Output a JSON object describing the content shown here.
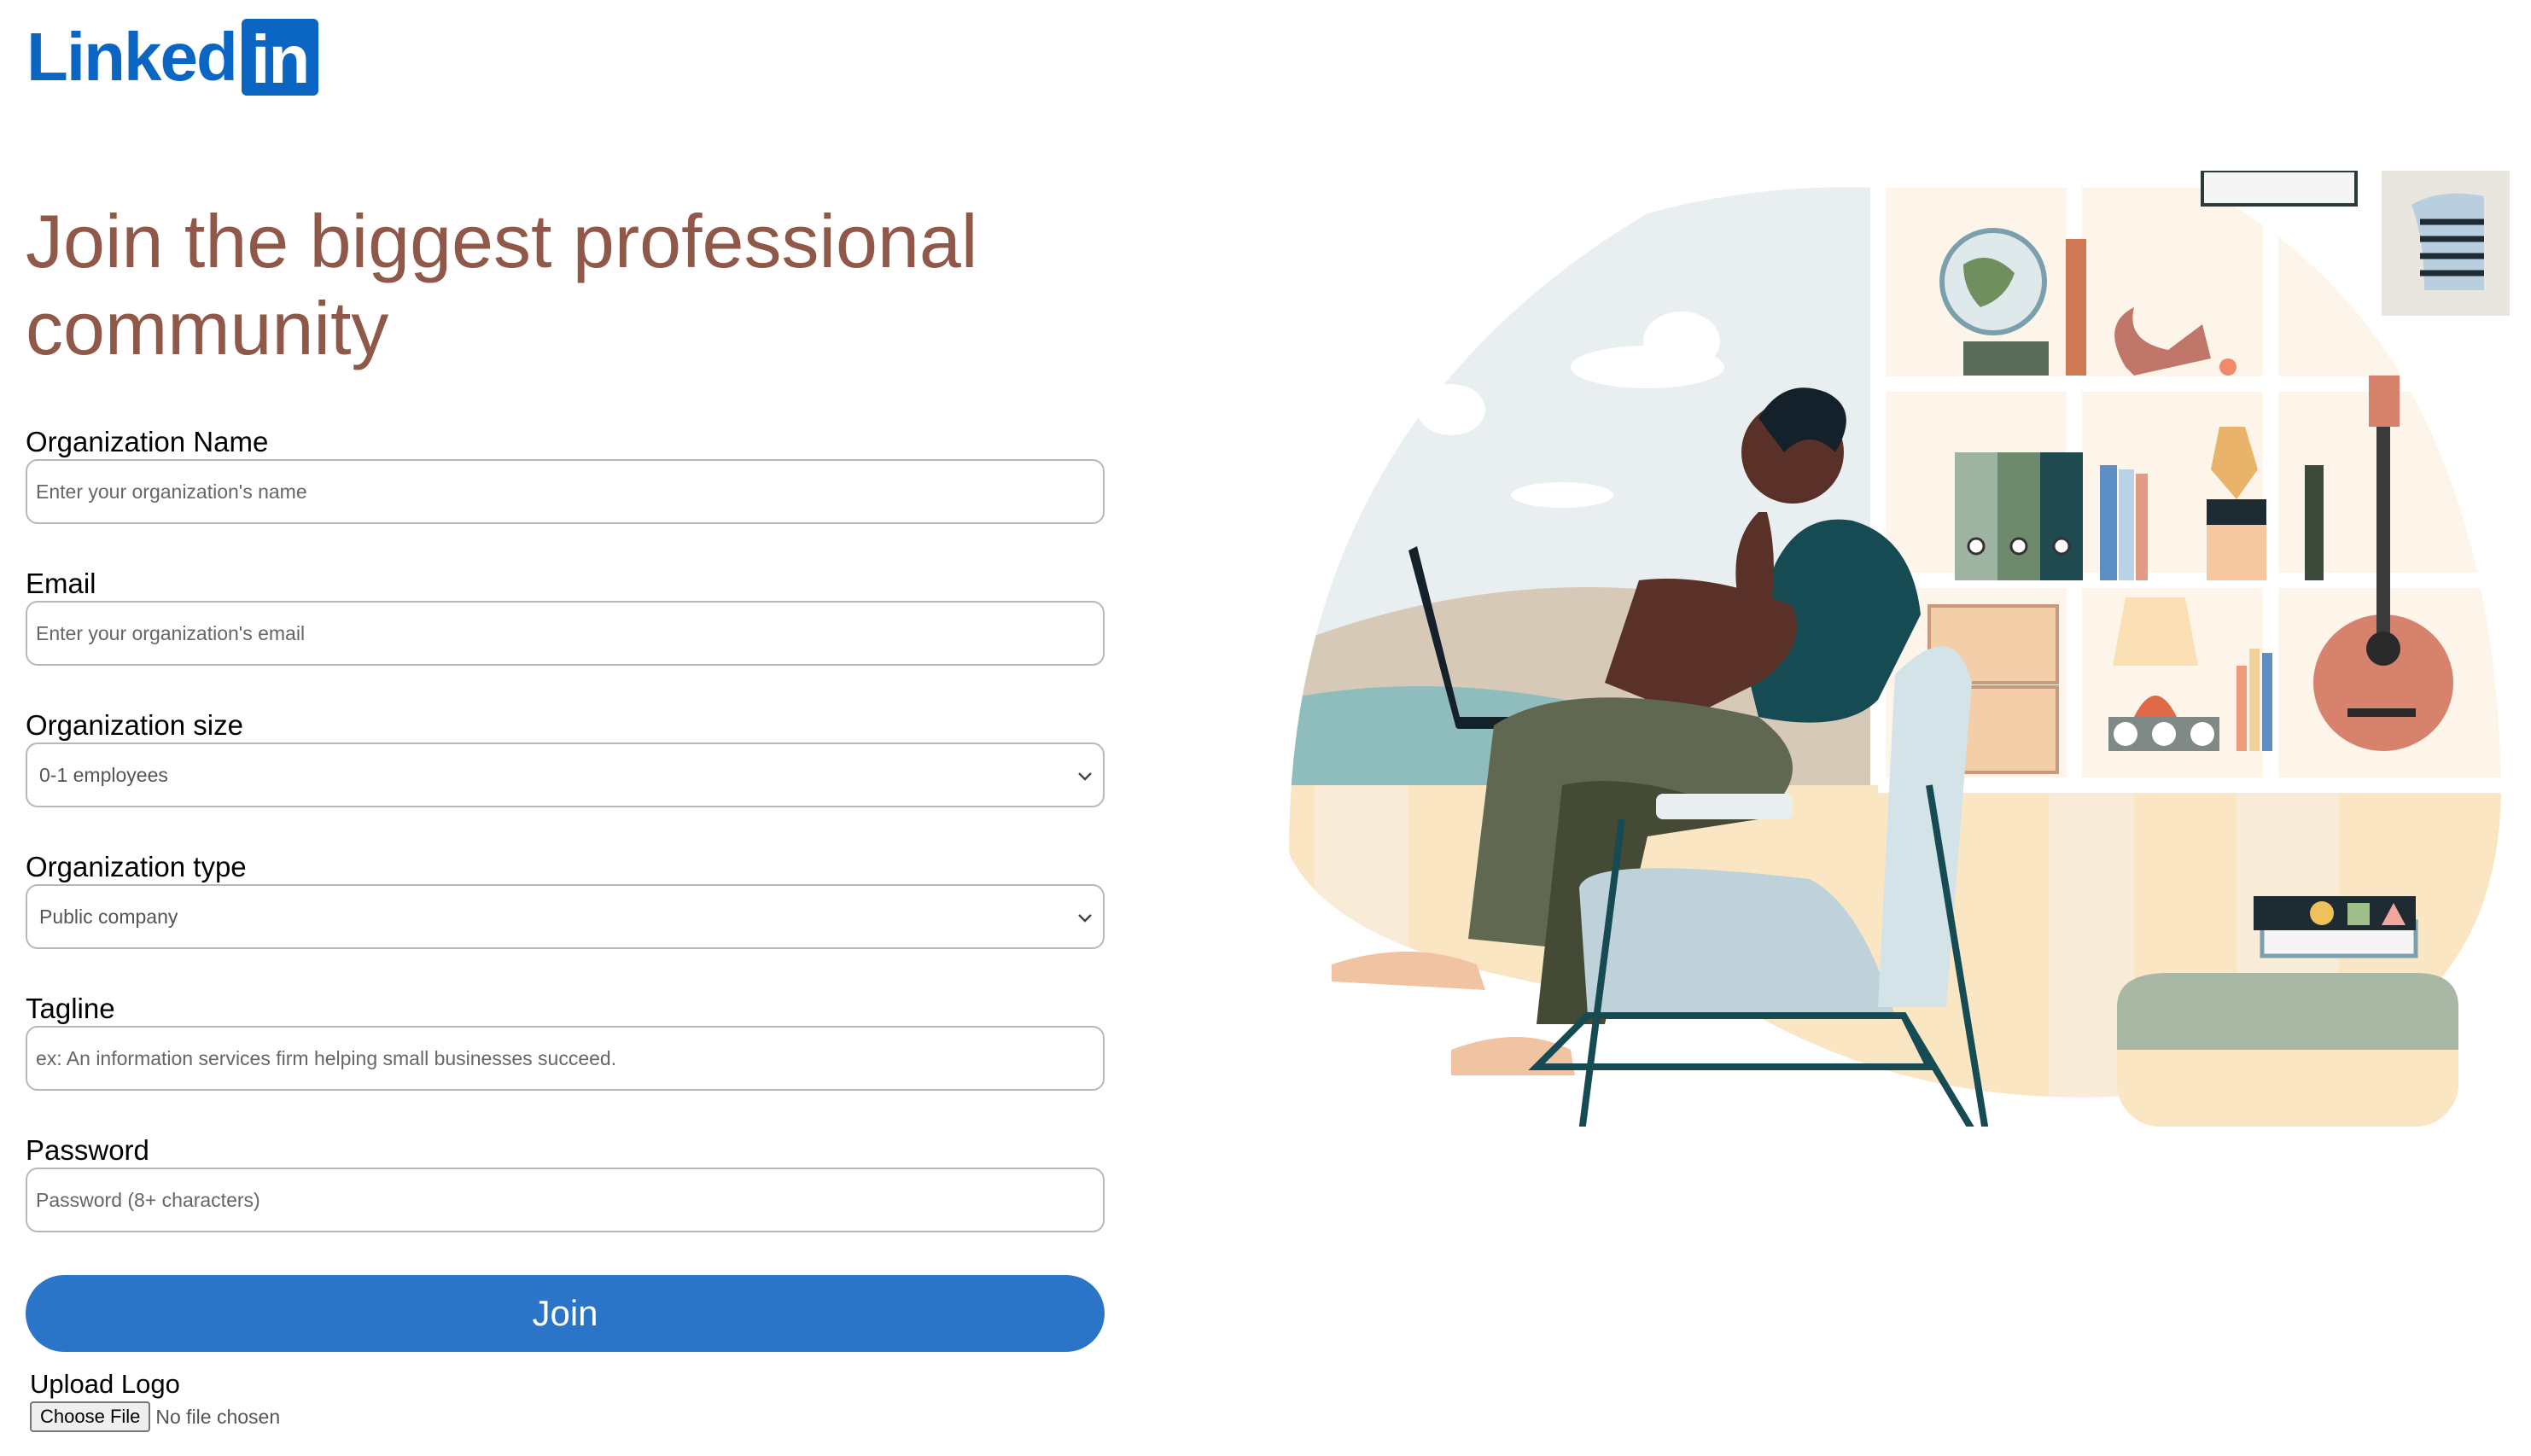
{
  "brand": {
    "logo_word": "Linked",
    "logo_box": "in"
  },
  "headline": "Join the biggest professional community",
  "form": {
    "org_name": {
      "label": "Organization Name",
      "placeholder": "Enter your organization's name"
    },
    "email": {
      "label": "Email",
      "placeholder": "Enter your organization's email"
    },
    "org_size": {
      "label": "Organization size",
      "selected": "0-1 employees"
    },
    "org_type": {
      "label": "Organization type",
      "selected": "Public company"
    },
    "tagline": {
      "label": "Tagline",
      "placeholder": "ex: An information services firm helping small businesses succeed."
    },
    "password": {
      "label": "Password",
      "placeholder": "Password (8+ characters)"
    },
    "join_label": "Join",
    "upload": {
      "label": "Upload Logo",
      "button": "Choose File",
      "status": "No file chosen"
    }
  },
  "colors": {
    "brand": "#0a66c2",
    "headline": "#8f5849",
    "button": "#2a75c8"
  },
  "icons": {
    "select_arrow": "chevron-down-icon"
  }
}
